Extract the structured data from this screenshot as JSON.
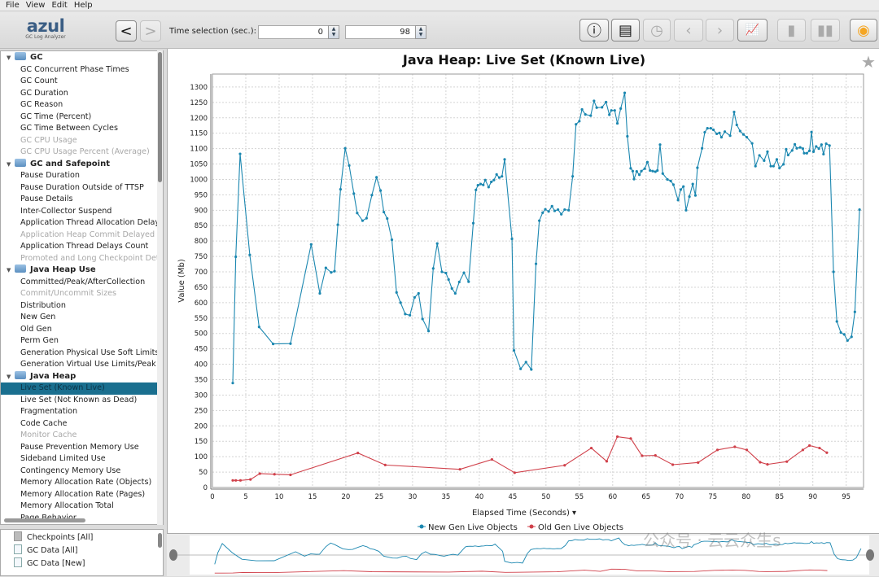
{
  "menu": [
    "File",
    "View",
    "Edit",
    "Help"
  ],
  "logo": {
    "name": "azul",
    "subtitle": "GC Log Analyzer"
  },
  "toolbar": {
    "back": "<",
    "forward": ">",
    "time_selection_label": "Time selection (sec.):",
    "time_start": "0",
    "time_end": "98",
    "buttons": [
      {
        "name": "info-icon",
        "glyph": "ⓘ",
        "enabled": true
      },
      {
        "name": "report-icon",
        "glyph": "▤",
        "enabled": true
      },
      {
        "name": "clock-icon",
        "glyph": "◷",
        "enabled": false
      },
      {
        "name": "prev-icon",
        "glyph": "‹",
        "enabled": false
      },
      {
        "name": "next-icon",
        "glyph": "›",
        "enabled": false
      },
      {
        "name": "chart-type-icon",
        "glyph": "📈",
        "enabled": true
      },
      {
        "name": "bookmark-icon",
        "glyph": "▮",
        "enabled": false
      },
      {
        "name": "bookmarks-icon",
        "glyph": "▮▮",
        "enabled": false
      },
      {
        "name": "camera-icon",
        "glyph": "◉",
        "enabled": true
      }
    ],
    "camera_color": "#f5a623"
  },
  "tree": [
    {
      "type": "group",
      "label": "GC"
    },
    {
      "label": "GC Concurrent Phase Times"
    },
    {
      "label": "GC Count"
    },
    {
      "label": "GC Duration"
    },
    {
      "label": "GC Reason"
    },
    {
      "label": "GC Time (Percent)"
    },
    {
      "label": "GC Time Between Cycles"
    },
    {
      "label": "GC CPU Usage",
      "disabled": true
    },
    {
      "label": "GC CPU Usage Percent (Average)",
      "disabled": true
    },
    {
      "type": "group",
      "label": "GC and Safepoint"
    },
    {
      "label": "Pause Duration"
    },
    {
      "label": "Pause Duration Outside of TTSP"
    },
    {
      "label": "Pause Details"
    },
    {
      "label": "Inter-Collector Suspend"
    },
    {
      "label": "Application Thread Allocation Delays"
    },
    {
      "label": "Application Heap Commit Delayed",
      "disabled": true
    },
    {
      "label": "Application Thread Delays Count"
    },
    {
      "label": "Promoted and Long Checkpoint Details",
      "disabled": true
    },
    {
      "type": "group",
      "label": "Java Heap Use"
    },
    {
      "label": "Committed/Peak/AfterCollection"
    },
    {
      "label": "Commit/Uncommit Sizes",
      "disabled": true
    },
    {
      "label": "Distribution"
    },
    {
      "label": "New Gen"
    },
    {
      "label": "Old Gen"
    },
    {
      "label": "Perm Gen"
    },
    {
      "label": "Generation Physical Use Soft Limits"
    },
    {
      "label": "Generation Virtual Use Limits/Peak"
    },
    {
      "type": "group",
      "label": "Java Heap"
    },
    {
      "label": "Live Set (Known Live)",
      "selected": true
    },
    {
      "label": "Live Set (Not Known as Dead)"
    },
    {
      "label": "Fragmentation"
    },
    {
      "label": "Code Cache"
    },
    {
      "label": "Monitor Cache",
      "disabled": true
    },
    {
      "label": "Pause Prevention Memory Use"
    },
    {
      "label": "Sideband Limited Use"
    },
    {
      "label": "Contingency Memory Use"
    },
    {
      "label": "Memory Allocation Rate (Objects)"
    },
    {
      "label": "Memory Allocation Rate (Pages)"
    },
    {
      "label": "Memory Allocation Total"
    },
    {
      "label": "Page Behavior"
    }
  ],
  "files": [
    {
      "label": "Checkpoints [All]",
      "icon": "gray"
    },
    {
      "label": "GC Data [All]"
    },
    {
      "label": "GC Data [New]"
    }
  ],
  "watermark": "公众号 · 云云众生s",
  "chart_data": {
    "type": "line",
    "title": "Java Heap: Live Set (Known Live)",
    "xlabel": "Elapsed Time (Seconds) ▾",
    "ylabel": "Value (Mb)",
    "xlim": [
      0,
      97.6
    ],
    "ylim": [
      0,
      1342
    ],
    "xticks": [
      0,
      5,
      10,
      15,
      20,
      25,
      30,
      35,
      40,
      45,
      50,
      55,
      60,
      65,
      70,
      75,
      80,
      85,
      90,
      95
    ],
    "yticks": [
      0,
      50,
      100,
      150,
      200,
      250,
      300,
      350,
      400,
      450,
      500,
      550,
      600,
      650,
      700,
      750,
      800,
      850,
      900,
      950,
      1000,
      1050,
      1100,
      1150,
      1200,
      1250,
      1300
    ],
    "grid": true,
    "legend_position": "bottom",
    "series": [
      {
        "name": "New Gen Live Objects",
        "color": "#1b87b0",
        "points": [
          [
            3.05,
            339
          ],
          [
            3.5,
            749
          ],
          [
            4.15,
            1083
          ],
          [
            5.6,
            755
          ],
          [
            7.0,
            521
          ],
          [
            9.1,
            466
          ],
          [
            11.7,
            467
          ],
          [
            14.8,
            789
          ],
          [
            16.1,
            630
          ],
          [
            17.0,
            713
          ],
          [
            17.8,
            698
          ],
          [
            18.3,
            702
          ],
          [
            18.8,
            853
          ],
          [
            19.2,
            968
          ],
          [
            19.9,
            1101
          ],
          [
            20.5,
            1045
          ],
          [
            21.2,
            954
          ],
          [
            21.7,
            891
          ],
          [
            22.5,
            866
          ],
          [
            23.1,
            874
          ],
          [
            23.9,
            949
          ],
          [
            24.6,
            1007
          ],
          [
            25.2,
            964
          ],
          [
            25.7,
            894
          ],
          [
            26.2,
            873
          ],
          [
            26.9,
            804
          ],
          [
            27.6,
            633
          ],
          [
            28.2,
            600
          ],
          [
            28.9,
            563
          ],
          [
            29.6,
            559
          ],
          [
            30.3,
            617
          ],
          [
            30.9,
            630
          ],
          [
            31.5,
            547
          ],
          [
            32.4,
            508
          ],
          [
            33.1,
            711
          ],
          [
            33.7,
            792
          ],
          [
            34.4,
            700
          ],
          [
            35.0,
            696
          ],
          [
            35.4,
            675
          ],
          [
            35.9,
            646
          ],
          [
            36.4,
            630
          ],
          [
            37.0,
            667
          ],
          [
            37.7,
            697
          ],
          [
            38.4,
            668
          ],
          [
            39.1,
            858
          ],
          [
            39.5,
            966
          ],
          [
            39.8,
            981
          ],
          [
            40.2,
            985
          ],
          [
            40.6,
            982
          ],
          [
            40.9,
            998
          ],
          [
            41.4,
            975
          ],
          [
            41.8,
            992
          ],
          [
            42.2,
            998
          ],
          [
            42.6,
            1016
          ],
          [
            43.0,
            1006
          ],
          [
            43.4,
            1010
          ],
          [
            43.8,
            1065
          ],
          [
            44.9,
            807
          ],
          [
            45.2,
            445
          ],
          [
            46.2,
            385
          ],
          [
            47.0,
            407
          ],
          [
            47.8,
            383
          ],
          [
            48.5,
            726
          ],
          [
            49.0,
            866
          ],
          [
            49.5,
            892
          ],
          [
            49.9,
            903
          ],
          [
            50.4,
            896
          ],
          [
            50.9,
            913
          ],
          [
            51.3,
            898
          ],
          [
            51.8,
            902
          ],
          [
            52.3,
            887
          ],
          [
            52.8,
            902
          ],
          [
            53.4,
            900
          ],
          [
            54.0,
            1010
          ],
          [
            54.5,
            1179
          ],
          [
            55.0,
            1189
          ],
          [
            55.4,
            1227
          ],
          [
            55.9,
            1211
          ],
          [
            56.7,
            1207
          ],
          [
            57.2,
            1255
          ],
          [
            57.6,
            1233
          ],
          [
            58.4,
            1234
          ],
          [
            59.0,
            1251
          ],
          [
            59.5,
            1210
          ],
          [
            59.8,
            1224
          ],
          [
            60.3,
            1224
          ],
          [
            60.7,
            1182
          ],
          [
            61.2,
            1230
          ],
          [
            61.8,
            1281
          ],
          [
            62.2,
            1140
          ],
          [
            62.7,
            1036
          ],
          [
            63.0,
            1027
          ],
          [
            63.2,
            1001
          ],
          [
            63.6,
            1026
          ],
          [
            64.0,
            1015
          ],
          [
            64.3,
            1027
          ],
          [
            64.8,
            1035
          ],
          [
            65.2,
            1056
          ],
          [
            65.6,
            1029
          ],
          [
            66.0,
            1027
          ],
          [
            66.4,
            1025
          ],
          [
            66.7,
            1029
          ],
          [
            67.1,
            1113
          ],
          [
            67.5,
            1019
          ],
          [
            68.2,
            1000
          ],
          [
            68.7,
            995
          ],
          [
            69.1,
            983
          ],
          [
            69.8,
            933
          ],
          [
            70.2,
            967
          ],
          [
            70.6,
            977
          ],
          [
            71.0,
            900
          ],
          [
            71.5,
            944
          ],
          [
            72.0,
            985
          ],
          [
            72.4,
            948
          ],
          [
            72.7,
            1038
          ],
          [
            73.4,
            1101
          ],
          [
            73.8,
            1153
          ],
          [
            74.2,
            1166
          ],
          [
            74.7,
            1166
          ],
          [
            75.1,
            1161
          ],
          [
            75.6,
            1148
          ],
          [
            76.0,
            1151
          ],
          [
            76.3,
            1137
          ],
          [
            76.8,
            1155
          ],
          [
            77.6,
            1142
          ],
          [
            78.2,
            1219
          ],
          [
            78.6,
            1177
          ],
          [
            79.1,
            1157
          ],
          [
            79.6,
            1146
          ],
          [
            80.1,
            1137
          ],
          [
            80.9,
            1117
          ],
          [
            81.4,
            1043
          ],
          [
            82.0,
            1078
          ],
          [
            82.7,
            1061
          ],
          [
            83.2,
            1090
          ],
          [
            83.7,
            1043
          ],
          [
            84.1,
            1043
          ],
          [
            84.6,
            1065
          ],
          [
            85.0,
            1037
          ],
          [
            85.6,
            1049
          ],
          [
            86.0,
            1098
          ],
          [
            86.3,
            1079
          ],
          [
            86.9,
            1094
          ],
          [
            87.3,
            1114
          ],
          [
            87.6,
            1101
          ],
          [
            88.1,
            1104
          ],
          [
            88.5,
            1100
          ],
          [
            88.7,
            1085
          ],
          [
            89.1,
            1085
          ],
          [
            89.5,
            1093
          ],
          [
            89.8,
            1154
          ],
          [
            90.1,
            1090
          ],
          [
            90.5,
            1107
          ],
          [
            90.9,
            1100
          ],
          [
            91.3,
            1113
          ],
          [
            91.6,
            1082
          ],
          [
            92.0,
            1116
          ],
          [
            92.5,
            1110
          ],
          [
            93.1,
            700
          ],
          [
            93.6,
            539
          ],
          [
            94.2,
            503
          ],
          [
            94.7,
            497
          ],
          [
            95.2,
            477
          ],
          [
            95.8,
            489
          ],
          [
            96.3,
            570
          ],
          [
            97.0,
            902
          ]
        ]
      },
      {
        "name": "Old Gen Live Objects",
        "color": "#d0404a",
        "points": [
          [
            3.05,
            23
          ],
          [
            3.5,
            23
          ],
          [
            4.2,
            23
          ],
          [
            5.7,
            26
          ],
          [
            7.1,
            45
          ],
          [
            9.3,
            43
          ],
          [
            11.7,
            41
          ],
          [
            21.8,
            112
          ],
          [
            25.9,
            73
          ],
          [
            37.1,
            59
          ],
          [
            41.9,
            91
          ],
          [
            45.3,
            48
          ],
          [
            52.8,
            72
          ],
          [
            56.8,
            128
          ],
          [
            59.1,
            85
          ],
          [
            60.7,
            165
          ],
          [
            62.7,
            159
          ],
          [
            64.4,
            103
          ],
          [
            66.4,
            104
          ],
          [
            69.0,
            74
          ],
          [
            72.8,
            81
          ],
          [
            75.7,
            122
          ],
          [
            78.3,
            132
          ],
          [
            80.1,
            122
          ],
          [
            82.1,
            82
          ],
          [
            83.2,
            75
          ],
          [
            86.1,
            84
          ],
          [
            88.5,
            122
          ],
          [
            89.5,
            136
          ],
          [
            91.0,
            128
          ],
          [
            92.1,
            113
          ]
        ]
      }
    ]
  }
}
